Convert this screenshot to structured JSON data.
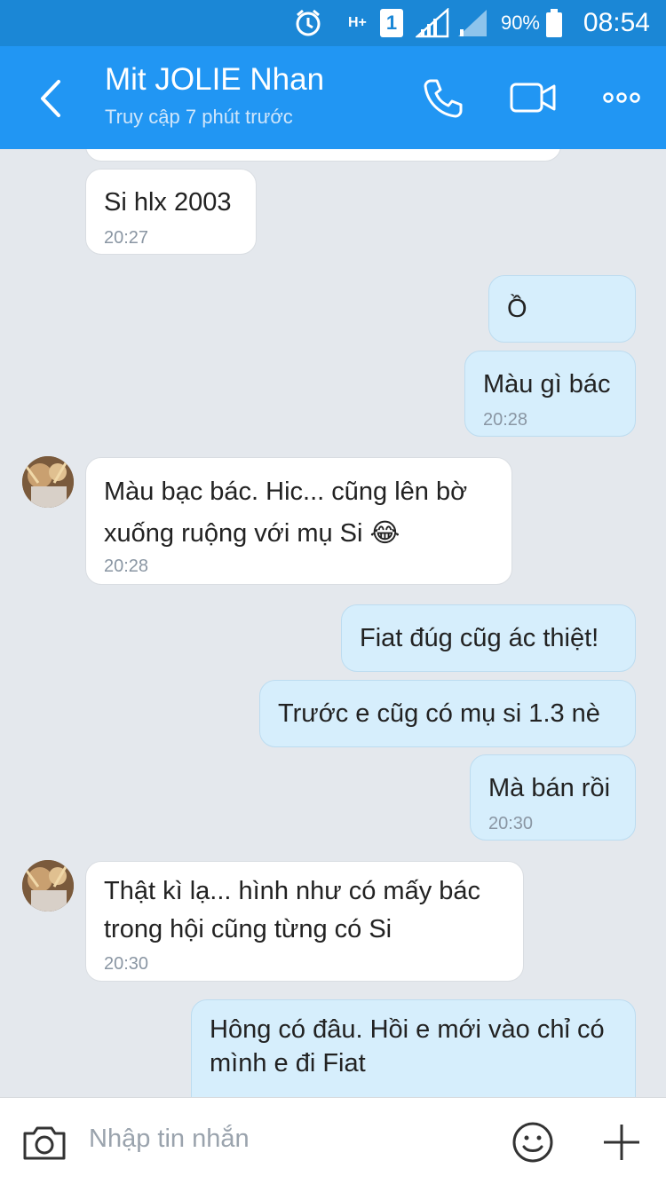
{
  "status_bar": {
    "battery": "90%",
    "time": "08:54",
    "network": "H+",
    "sim": "1"
  },
  "header": {
    "title": "Mit JOLIE Nhan",
    "subtitle": "Truy cập 7 phút trước"
  },
  "messages": [
    {
      "side": "in",
      "text": "Si hlx 2003",
      "time": "20:27"
    },
    {
      "side": "out",
      "text": "Ồ",
      "time": ""
    },
    {
      "side": "out",
      "text": "Màu gì bác",
      "time": "20:28"
    },
    {
      "side": "in",
      "line1": "Màu bạc bác. Hic... cũng lên bờ",
      "line2": "xuống ruộng với mụ Si",
      "emoji": "😂",
      "time": "20:28"
    },
    {
      "side": "out",
      "text": "Fiat đúg cũg ác thiệt!",
      "time": ""
    },
    {
      "side": "out",
      "text": "Trước e cũg có mụ si 1.3 nè",
      "time": ""
    },
    {
      "side": "out",
      "text": "Mà bán rồi",
      "time": "20:30"
    },
    {
      "side": "in",
      "line1": "Thật kì lạ... hình như có mấy bác",
      "line2": "trong hội cũng từng có Si",
      "time": "20:30"
    },
    {
      "side": "out",
      "line1": "Hông có đâu. Hồi e mới vào chỉ có",
      "line2": "mình e đi Fiat",
      "time": ""
    }
  ],
  "input": {
    "placeholder": "Nhập tin nhắn"
  },
  "icons": [
    "back-icon",
    "phone-icon",
    "video-call-icon",
    "more-options-icon",
    "camera-icon",
    "emoji-icon",
    "plus-icon"
  ],
  "colors": {
    "header": "#2196f3",
    "status_bar": "#1b87d6",
    "outgoing_bubble": "#d6eefc",
    "incoming_bubble": "#ffffff",
    "background": "#e4e8ed"
  }
}
